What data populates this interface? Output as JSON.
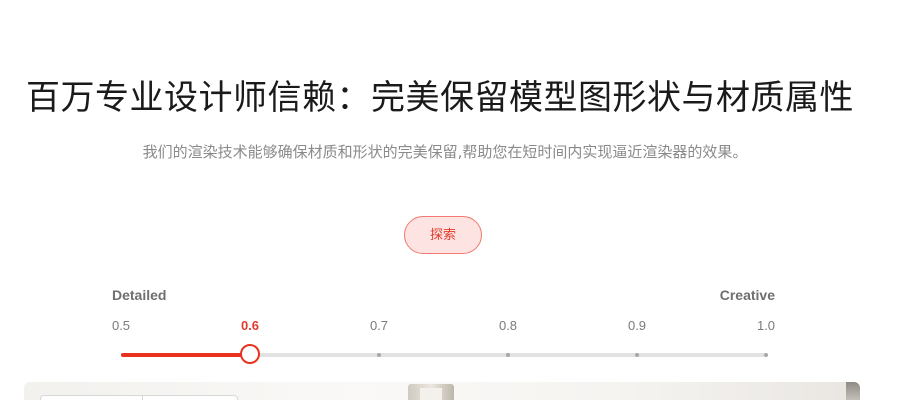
{
  "hero": {
    "title": "百万专业设计师信赖：完美保留模型图形状与材质属性",
    "subtitle": "我们的渲染技术能够确保材质和形状的完美保留,帮助您在短时间内实现逼近渲染器的效果。",
    "explore_label": "探索"
  },
  "slider": {
    "left_label": "Detailed",
    "right_label": "Creative",
    "ticks": [
      "0.5",
      "0.6",
      "0.7",
      "0.8",
      "0.9",
      "1.0"
    ],
    "min": 0.5,
    "max": 1.0,
    "value": 0.6,
    "active_color": "#e8321f",
    "track_color": "#e2e2e2"
  }
}
